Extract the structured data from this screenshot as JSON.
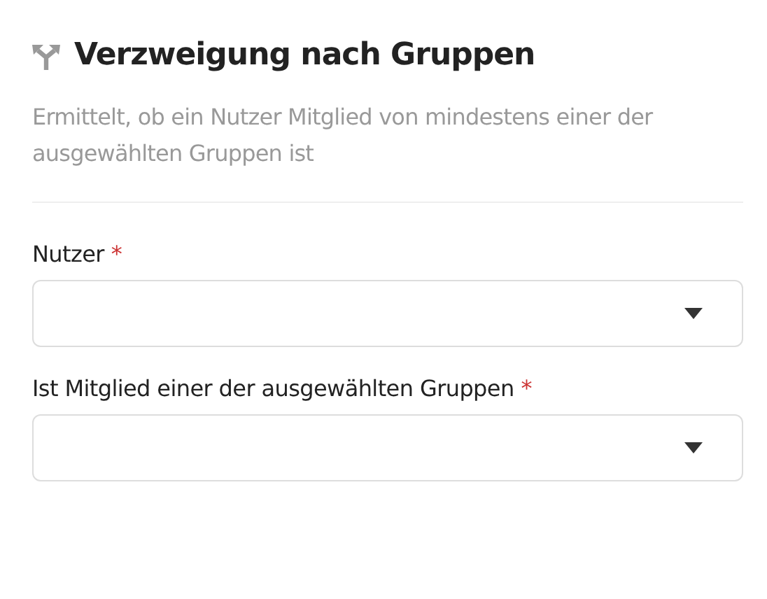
{
  "title": "Verzweigung nach Gruppen",
  "description": "Ermittelt, ob ein Nutzer Mitglied von mindestens einer der ausgewählten Gruppen ist",
  "fields": [
    {
      "label": "Nutzer",
      "required": true,
      "required_mark": "*"
    },
    {
      "label": "Ist Mitglied einer der ausgewählten Gruppen",
      "required": true,
      "required_mark": "*"
    }
  ]
}
